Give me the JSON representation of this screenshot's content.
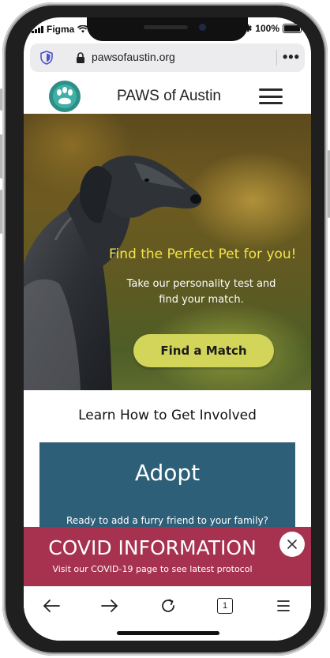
{
  "status_bar": {
    "carrier": "Figma",
    "battery_percent": "100%"
  },
  "browser": {
    "url": "pawsofaustin.org",
    "more_menu_icon": "ellipsis-icon",
    "tab_count": "1"
  },
  "site": {
    "title": "PAWS of Austin",
    "logo_icon": "paw-print-icon",
    "menu_icon": "hamburger-icon"
  },
  "hero": {
    "heading": "Find the Perfect Pet for you!",
    "subtext": "Take our personality test and find your match.",
    "cta_label": "Find a Match"
  },
  "involved": {
    "title": "Learn How to Get Involved",
    "card": {
      "title": "Adopt",
      "text": "Ready to add a furry friend to your family?"
    }
  },
  "covid_banner": {
    "title": "COVID INFORMATION",
    "subtitle": "Visit our COVID-19 page to see latest protocol"
  },
  "colors": {
    "brand_teal": "#2f8f87",
    "cta_yellow_green": "#d3d55a",
    "hero_heading_yellow": "#f3e24a",
    "card_blue": "#2e5f78",
    "covid_red": "#a6324f"
  }
}
